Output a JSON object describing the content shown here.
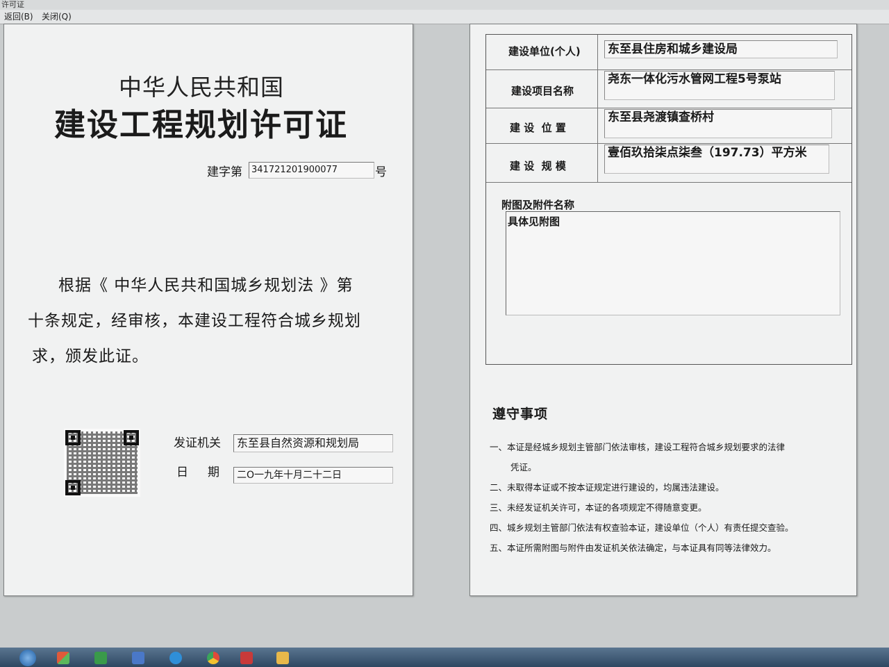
{
  "window": {
    "title": "许可证"
  },
  "menu": {
    "back": "返回(B)",
    "close": "关闭(Q)"
  },
  "left_page": {
    "title_country": "中华人民共和国",
    "title_main": "建设工程规划许可证",
    "permit_no_label": "建字第",
    "permit_no_value": "341721201900077",
    "permit_no_suffix": "号",
    "body_line1": "根据《 中华人民共和国城乡规划法 》第",
    "body_line2": "十条规定，经审核，本建设工程符合城乡规划",
    "body_line3": "求，颁发此证。",
    "issuer_label": "发证机关",
    "issuer_value": "东至县自然资源和规划局",
    "date_label": "日期",
    "date_value": "二O一九年十月二十二日"
  },
  "right_page": {
    "fields": [
      {
        "label": "建设单位(个人)",
        "value": "东至县住房和城乡建设局"
      },
      {
        "label": "建设项目名称",
        "value": "尧东一体化污水管网工程5号泵站"
      },
      {
        "label": "建 设  位 置",
        "value": "东至县尧渡镇查桥村"
      },
      {
        "label": "建 设  规 模",
        "value": "壹佰玖拾柒点柒叁（197.73）平方米"
      }
    ],
    "attachment_label": "附图及附件名称",
    "attachment_value": "具体见附图",
    "notice_title": "遵守事项",
    "notices": [
      "一、本证是经城乡规划主管部门依法审核，建设工程符合城乡规划要求的法律",
      "凭证。",
      "二、未取得本证或不按本证规定进行建设的，均属违法建设。",
      "三、未经发证机关许可，本证的各项规定不得随意变更。",
      "四、城乡规划主管部门依法有权查验本证，建设单位（个人）有责任提交查验。",
      "五、本证所需附图与附件由发证机关依法确定，与本证具有同等法律效力。"
    ]
  },
  "icons": {
    "qr": "qr-code-icon",
    "taskbar": [
      "start-orb-icon",
      "windows-icon",
      "chart-app-icon",
      "bird-app-icon",
      "browser-s-icon",
      "chrome-icon",
      "shield-app-icon",
      "folder-icon"
    ]
  }
}
